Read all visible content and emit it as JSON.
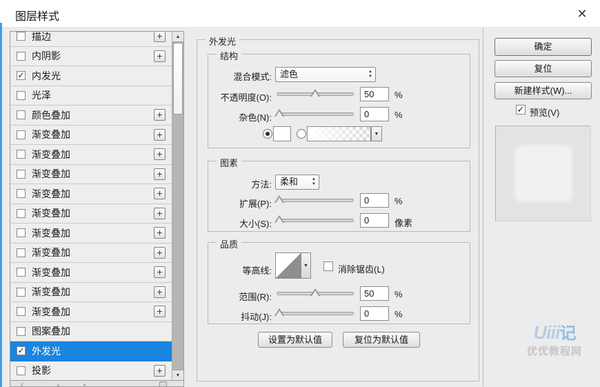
{
  "window": {
    "title": "图层样式"
  },
  "sidebar": {
    "items": [
      {
        "label": "描边",
        "checked": false,
        "has_plus": true,
        "selected": false
      },
      {
        "label": "内阴影",
        "checked": false,
        "has_plus": true,
        "selected": false
      },
      {
        "label": "内发光",
        "checked": true,
        "has_plus": false,
        "selected": false
      },
      {
        "label": "光泽",
        "checked": false,
        "has_plus": false,
        "selected": false
      },
      {
        "label": "颜色叠加",
        "checked": false,
        "has_plus": true,
        "selected": false
      },
      {
        "label": "渐变叠加",
        "checked": false,
        "has_plus": true,
        "selected": false
      },
      {
        "label": "渐变叠加",
        "checked": false,
        "has_plus": true,
        "selected": false
      },
      {
        "label": "渐变叠加",
        "checked": false,
        "has_plus": true,
        "selected": false
      },
      {
        "label": "渐变叠加",
        "checked": false,
        "has_plus": true,
        "selected": false
      },
      {
        "label": "渐变叠加",
        "checked": false,
        "has_plus": true,
        "selected": false
      },
      {
        "label": "渐变叠加",
        "checked": false,
        "has_plus": true,
        "selected": false
      },
      {
        "label": "渐变叠加",
        "checked": false,
        "has_plus": true,
        "selected": false
      },
      {
        "label": "渐变叠加",
        "checked": false,
        "has_plus": true,
        "selected": false
      },
      {
        "label": "渐变叠加",
        "checked": false,
        "has_plus": true,
        "selected": false
      },
      {
        "label": "渐变叠加",
        "checked": false,
        "has_plus": true,
        "selected": false
      },
      {
        "label": "图案叠加",
        "checked": false,
        "has_plus": false,
        "selected": false
      },
      {
        "label": "外发光",
        "checked": true,
        "has_plus": false,
        "selected": true
      },
      {
        "label": "投影",
        "checked": false,
        "has_plus": true,
        "selected": false
      }
    ],
    "check_mark": "✓"
  },
  "panel": {
    "title": "外发光",
    "structure": {
      "title": "结构",
      "blend_mode_label": "混合模式:",
      "blend_mode_value": "滤色",
      "opacity_label": "不透明度(O):",
      "opacity_value": "50",
      "opacity_unit": "%",
      "opacity_pct": 50,
      "noise_label": "杂色(N):",
      "noise_value": "0",
      "noise_unit": "%",
      "noise_pct": 4
    },
    "elements": {
      "title": "图素",
      "technique_label": "方法:",
      "technique_value": "柔和",
      "spread_label": "扩展(P):",
      "spread_value": "0",
      "spread_unit": "%",
      "spread_pct": 4,
      "size_label": "大小(S):",
      "size_value": "0",
      "size_unit": "像素",
      "size_pct": 4
    },
    "quality": {
      "title": "品质",
      "contour_label": "等高线:",
      "antialias_label": "消除锯齿(L)",
      "antialias_checked": false,
      "range_label": "范围(R):",
      "range_value": "50",
      "range_unit": "%",
      "range_pct": 50,
      "jitter_label": "抖动(J):",
      "jitter_value": "0",
      "jitter_unit": "%",
      "jitter_pct": 4
    },
    "make_default_label": "设置为默认值",
    "reset_default_label": "复位为默认值"
  },
  "actions": {
    "ok": "确定",
    "reset": "复位",
    "new_style": "新建样式(W)...",
    "preview_label": "预览(V)",
    "preview_mark": "✓"
  },
  "watermark": {
    "logo1": "Uiii",
    "logo2": "记",
    "text": "优优教程网"
  },
  "colors": {
    "selection": "#1a84e0",
    "left_edge": "#3d9fe8",
    "titlebar": "#ffffff",
    "dialog_bg": "#ececec"
  }
}
